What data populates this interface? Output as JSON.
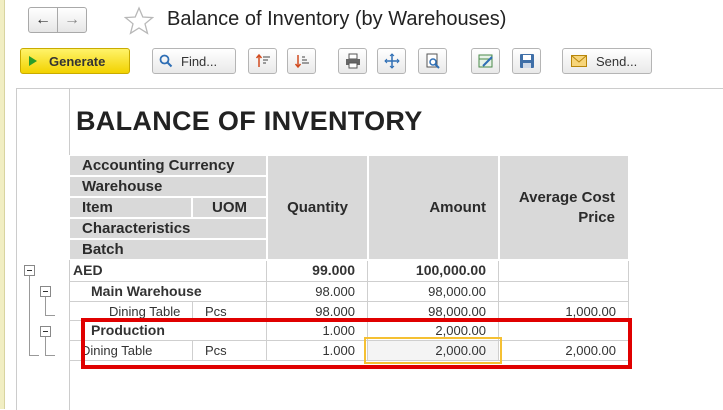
{
  "window": {
    "title": "Balance of Inventory (by Warehouses)"
  },
  "toolbar": {
    "generate_label": "Generate",
    "find_label": "Find...",
    "send_label": "Send..."
  },
  "report": {
    "title": "BALANCE OF INVENTORY",
    "headers": {
      "accounting_currency": "Accounting Currency",
      "warehouse": "Warehouse",
      "item": "Item",
      "uom": "UOM",
      "characteristics": "Characteristics",
      "batch": "Batch",
      "quantity": "Quantity",
      "amount": "Amount",
      "avg_cost_line1": "Average Cost",
      "avg_cost_line2": "Price"
    },
    "rows": [
      {
        "name": "AED",
        "uom": "",
        "quantity": "99.000",
        "amount": "100,000.00",
        "avg": ""
      },
      {
        "name": "Main Warehouse",
        "uom": "",
        "quantity": "98.000",
        "amount": "98,000.00",
        "avg": ""
      },
      {
        "name": "Dining Table",
        "uom": "Pcs",
        "quantity": "98.000",
        "amount": "98,000.00",
        "avg": "1,000.00"
      },
      {
        "name": "Production",
        "uom": "",
        "quantity": "1.000",
        "amount": "2,000.00",
        "avg": ""
      },
      {
        "name": "Dining Table",
        "uom": "Pcs",
        "quantity": "1.000",
        "amount": "2,000.00",
        "avg": "2,000.00"
      }
    ]
  },
  "colors": {
    "highlight_red": "#e00000",
    "highlight_gold": "#f5c033",
    "generate_yellow": "#f2d200"
  }
}
